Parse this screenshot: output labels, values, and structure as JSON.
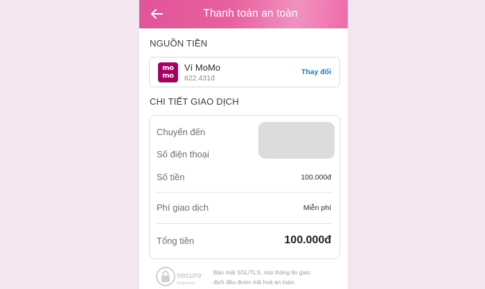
{
  "header": {
    "title": "Thanh toán an toàn",
    "back_icon": "arrow-left-icon"
  },
  "source": {
    "section_title": "NGUỒN TIỀN",
    "logo_text": "mo mo",
    "logo_color": "#a50064",
    "wallet_name": "Ví MoMo",
    "balance": "822.431đ",
    "change_label": "Thay đổi"
  },
  "details": {
    "section_title": "CHI TIẾT GIAO DỊCH",
    "transfer_to_label": "Chuyển đến",
    "phone_label": "Số điện thoại",
    "amount_label": "Số tiền",
    "amount_value": "100.000đ",
    "fee_label": "Phí giao dịch",
    "fee_value": "Miễn phí",
    "total_label": "Tổng tiền",
    "total_value": "100.000đ"
  },
  "security": {
    "badge_text": "secure",
    "badge_sub": "GlobalSign",
    "note_line1": "Bảo mật SSL/TLS, mọi thông tin giao",
    "note_line2": "dịch đều được mã hoá an toàn."
  },
  "colors": {
    "header_gradient_start": "#e05498",
    "header_gradient_end": "#ef6aa8",
    "link": "#1f7ab8",
    "background": "#f3e6ee"
  }
}
